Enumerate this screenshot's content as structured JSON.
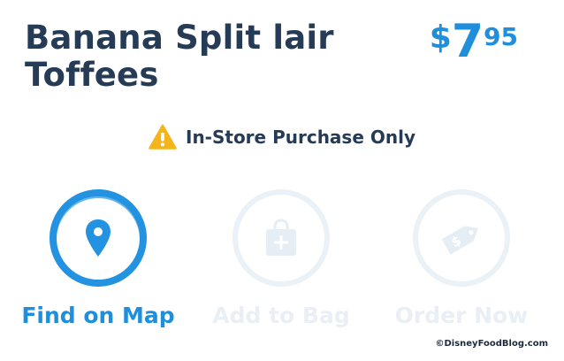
{
  "product": {
    "title_line1": "Banana Split lair",
    "title_line2": "Toffees",
    "price_currency": "$",
    "price_whole": "7",
    "price_cents": "95"
  },
  "notice": {
    "icon": "warning-icon",
    "text": "In-Store Purchase Only"
  },
  "actions": [
    {
      "label": "Find on Map",
      "icon": "map-pin-icon",
      "enabled": true
    },
    {
      "label": "Add to Bag",
      "icon": "shopping-bag-icon",
      "enabled": false
    },
    {
      "label": "Order Now",
      "icon": "price-tag-icon",
      "enabled": false
    }
  ],
  "watermark": "©DisneyFoodBlog.com",
  "colors": {
    "brand_blue": "#1f8fdc",
    "title_navy": "#253b56",
    "warning_yellow": "#f3b51b",
    "disabled": "#e9eff5"
  }
}
